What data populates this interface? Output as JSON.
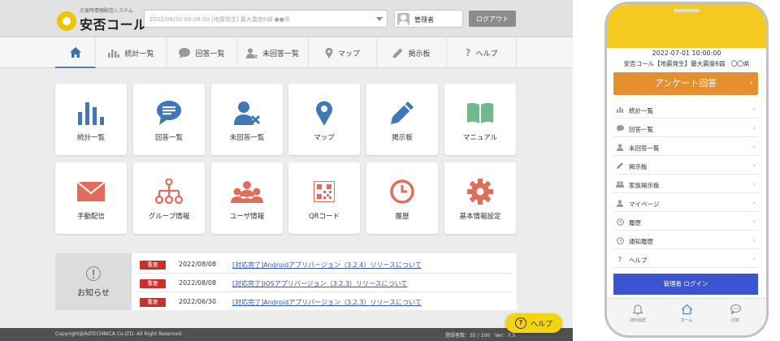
{
  "desktop": {
    "logo": {
      "subtitle": "災害時情報配信システム",
      "name": "安否コール"
    },
    "notice_selector": {
      "value": "2022/06/30 09:08:00 [地震発生] 最大震度6弱 ●●県"
    },
    "user": {
      "name": "管理者"
    },
    "logout_label": "ログアウト",
    "nav": [
      {
        "label": "",
        "icon": "home-icon"
      },
      {
        "label": "統計一覧",
        "icon": "bar-chart-icon"
      },
      {
        "label": "回答一覧",
        "icon": "chat-bubble-icon"
      },
      {
        "label": "未回答一覧",
        "icon": "user-x-icon"
      },
      {
        "label": "マップ",
        "icon": "map-pin-icon"
      },
      {
        "label": "掲示板",
        "icon": "pencil-icon"
      },
      {
        "label": "ヘルプ",
        "icon": "question-icon"
      }
    ],
    "tiles": [
      {
        "label": "統計一覧",
        "icon": "bar-chart-icon",
        "color": "#3e78b9"
      },
      {
        "label": "回答一覧",
        "icon": "chat-bubble-icon",
        "color": "#3e78b9"
      },
      {
        "label": "未回答一覧",
        "icon": "user-x-icon",
        "color": "#3e78b9"
      },
      {
        "label": "マップ",
        "icon": "map-pin-icon",
        "color": "#3e78b9"
      },
      {
        "label": "掲示板",
        "icon": "pencil-icon",
        "color": "#3e78b9"
      },
      {
        "label": "マニュアル",
        "icon": "book-icon",
        "color": "#6fb98a"
      },
      {
        "label": "手動配信",
        "icon": "envelope-icon",
        "color": "#e26b5b"
      },
      {
        "label": "グループ情報",
        "icon": "org-chart-icon",
        "color": "#e26b5b"
      },
      {
        "label": "ユーザ情報",
        "icon": "users-icon",
        "color": "#e26b5b"
      },
      {
        "label": "QRコード",
        "icon": "qr-code-icon",
        "color": "#e26b5b"
      },
      {
        "label": "履歴",
        "icon": "clock-icon",
        "color": "#e26b5b"
      },
      {
        "label": "基本情報設定",
        "icon": "gear-icon",
        "color": "#e26b5b"
      }
    ],
    "news": {
      "heading": "お知らせ",
      "items": [
        {
          "badge": "重要",
          "date": "2022/08/08",
          "title": "[対応完了]Androidアプリバージョン（3.2.4）リリースについて"
        },
        {
          "badge": "重要",
          "date": "2022/08/08",
          "title": "[対応完了]iOSアプリバージョン（3.2.3）リリースについて"
        },
        {
          "badge": "重要",
          "date": "2022/06/30",
          "title": "[対応完了]Androidアプリバージョン（3.2.3）リリースについて"
        }
      ]
    },
    "footer": {
      "copyright": "Copyright@AdTECHNICA Co.LTD. All Right Reserved.",
      "version": "登録者数：35 / 100　Ver：7.5"
    },
    "help_button": "ヘルプ",
    "accent": "#5a7aa8"
  },
  "mobile": {
    "date": "2022-07-01 10:00:00",
    "notice": "安否コール【地震発生】最大震度6弱　〇〇県",
    "survey_button": "アンケート回答",
    "menu": [
      {
        "label": "統計一覧",
        "icon": "bar-chart-icon"
      },
      {
        "label": "回答一覧",
        "icon": "chat-bubble-icon"
      },
      {
        "label": "未回答一覧",
        "icon": "user-icon"
      },
      {
        "label": "掲示板",
        "icon": "pencil-icon"
      },
      {
        "label": "家族掲示板",
        "icon": "users-icon"
      },
      {
        "label": "マイページ",
        "icon": "user-icon"
      },
      {
        "label": "履歴",
        "icon": "clock-icon"
      },
      {
        "label": "通知履歴",
        "icon": "clock-icon"
      },
      {
        "label": "ヘルプ",
        "icon": "question-icon"
      }
    ],
    "admin_login": "管理者 ログイン",
    "tabs": [
      {
        "label": "通知履歴",
        "icon": "bell-icon"
      },
      {
        "label": "ホーム",
        "icon": "home-icon"
      },
      {
        "label": "回答",
        "icon": "chat-icon"
      }
    ],
    "accent_yellow": "#f4c920",
    "accent_orange": "#e58f2e",
    "accent_blue": "#3b55d0"
  }
}
